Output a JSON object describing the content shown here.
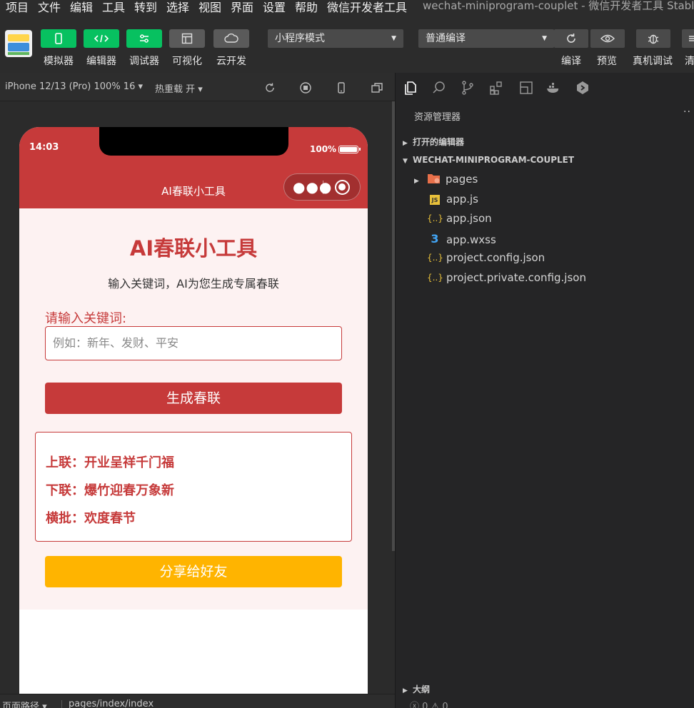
{
  "menu": {
    "items": [
      "项目",
      "文件",
      "编辑",
      "工具",
      "转到",
      "选择",
      "视图",
      "界面",
      "设置",
      "帮助",
      "微信开发者工具"
    ],
    "window_title": "wechat-miniprogram-couplet - 微信开发者工具 Stable"
  },
  "toolbar": {
    "simulator": "模拟器",
    "editor": "编辑器",
    "debugger": "调试器",
    "visual": "可视化",
    "cloud": "云开发",
    "mode_select": "小程序模式",
    "compile_select": "普通编译",
    "compile": "编译",
    "preview": "预览",
    "real_debug": "真机调试",
    "clear": "清"
  },
  "simbar": {
    "device": "iPhone 12/13 (Pro) 100% 16 ▾",
    "hot_reload": "热重载 开 ▾"
  },
  "phone": {
    "time": "14:03",
    "battery": "100%",
    "nav_title": "AI春联小工具",
    "title": "AI春联小工具",
    "subtitle": "输入关键词，AI为您生成专属春联",
    "input_label": "请输入关键词:",
    "input_placeholder": "例如：新年、发财、平安",
    "generate_button": "生成春联",
    "result": {
      "upper": "上联：开业呈祥千门福",
      "lower": "下联：爆竹迎春万象新",
      "horizontal": "横批：欢度春节"
    },
    "share_button": "分享给好友"
  },
  "statusbar": {
    "page_path_label": "页面路径 ▾",
    "page_path": "pages/index/index"
  },
  "explorer": {
    "title": "资源管理器",
    "open_editors": "打开的编辑器",
    "project": "WECHAT-MINIPROGRAM-COUPLET",
    "files": [
      {
        "name": "pages",
        "icon": "folder-icon"
      },
      {
        "name": "app.js",
        "icon": "js-icon"
      },
      {
        "name": "app.json",
        "icon": "json-icon"
      },
      {
        "name": "app.wxss",
        "icon": "css-icon"
      },
      {
        "name": "project.config.json",
        "icon": "json-icon"
      },
      {
        "name": "project.private.config.json",
        "icon": "json-icon"
      }
    ],
    "outline": "大纲",
    "errors": "0",
    "warnings": "0"
  }
}
